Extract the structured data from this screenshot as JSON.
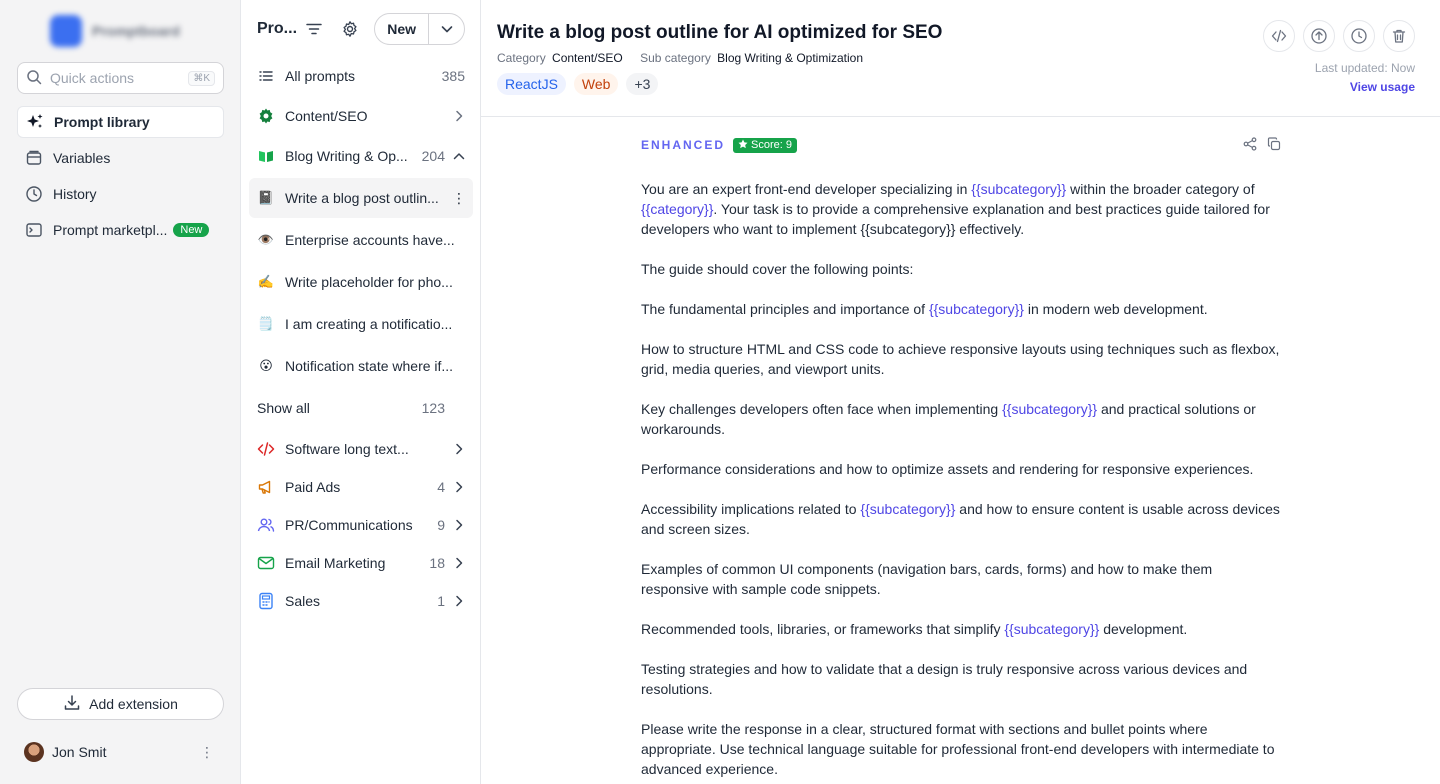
{
  "sidebar": {
    "brand_name": "Promptboard",
    "quick_actions": {
      "placeholder": "Quick actions",
      "shortcut": "⌘K"
    },
    "nav": [
      {
        "label": "Prompt library",
        "icon": "sparkles-icon",
        "active": true
      },
      {
        "label": "Variables",
        "icon": "database-icon"
      },
      {
        "label": "History",
        "icon": "clock-icon"
      },
      {
        "label": "Prompt marketpl...",
        "icon": "terminal-icon",
        "badge": "New"
      }
    ],
    "add_extension": "Add extension",
    "user_name": "Jon Smit"
  },
  "list": {
    "title": "Pro...",
    "new_label": "New",
    "all_prompts": {
      "label": "All prompts",
      "count": "385"
    },
    "category": {
      "label": "Content/SEO"
    },
    "subcategory": {
      "label": "Blog Writing & Op...",
      "count": "204"
    },
    "prompts": [
      {
        "label": "Write a blog post outlin...",
        "emoji": "📓"
      },
      {
        "label": "Enterprise accounts have...",
        "emoji": "👁️"
      },
      {
        "label": "Write placeholder for pho...",
        "emoji": "✍️"
      },
      {
        "label": "I am creating a notificatio...",
        "emoji": "🗒️"
      },
      {
        "label": "Notification state where if...",
        "emoji": "😮"
      }
    ],
    "show_all": {
      "label": "Show all",
      "count": "123"
    },
    "categories": [
      {
        "label": "Software long text...",
        "count": ""
      },
      {
        "label": "Paid Ads",
        "count": "4"
      },
      {
        "label": "PR/Communications",
        "count": "9"
      },
      {
        "label": "Email Marketing",
        "count": "18"
      },
      {
        "label": "Sales",
        "count": "1"
      }
    ]
  },
  "main": {
    "title": "Write a blog post outline for AI optimized for SEO",
    "category_label": "Category",
    "category_value": "Content/SEO",
    "subcategory_label": "Sub category",
    "subcategory_value": "Blog Writing & Optimization",
    "tags": [
      "ReactJS",
      "Web",
      "+3"
    ],
    "last_updated": "Last updated: Now",
    "view_usage": "View usage",
    "enhanced_label": "ENHANCED",
    "score": "Score: 9",
    "paragraphs": [
      [
        "You are an expert front-end developer specializing in ",
        "{{subcategory}}",
        " within the broader category of ",
        "{{category}}",
        ". Your task is to provide a comprehensive explanation and best practices guide tailored for developers who want to implement {{subcategory}} effectively."
      ],
      [
        "The guide should cover the following points:"
      ],
      [
        "The fundamental principles and importance of ",
        "{{subcategory}}",
        " in modern web development."
      ],
      [
        "How to structure HTML and CSS code to achieve responsive layouts using techniques such as flexbox, grid, media queries, and viewport units."
      ],
      [
        "Key challenges developers often face when implementing ",
        "{{subcategory}}",
        " and practical solutions or workarounds."
      ],
      [
        "Performance considerations and how to optimize assets and rendering for responsive experiences."
      ],
      [
        "Accessibility implications related to ",
        "{{subcategory}}",
        " and how to ensure content is usable across devices and screen sizes."
      ],
      [
        "Examples of common UI components (navigation bars, cards, forms) and how to make them responsive with sample code snippets."
      ],
      [
        "Recommended tools, libraries, or frameworks that simplify ",
        "{{subcategory}}",
        " development."
      ],
      [
        "Testing strategies and how to validate that a design is truly responsive across various devices and resolutions."
      ],
      [
        "Please write the response in a clear, structured format with sections and bullet points where appropriate. Use technical language suitable for professional front-end developers with intermediate to advanced experience."
      ]
    ]
  },
  "colors": {
    "accent": "#4f46e5",
    "success": "#16a34a",
    "sidebar_bg": "#f4f4f5"
  }
}
